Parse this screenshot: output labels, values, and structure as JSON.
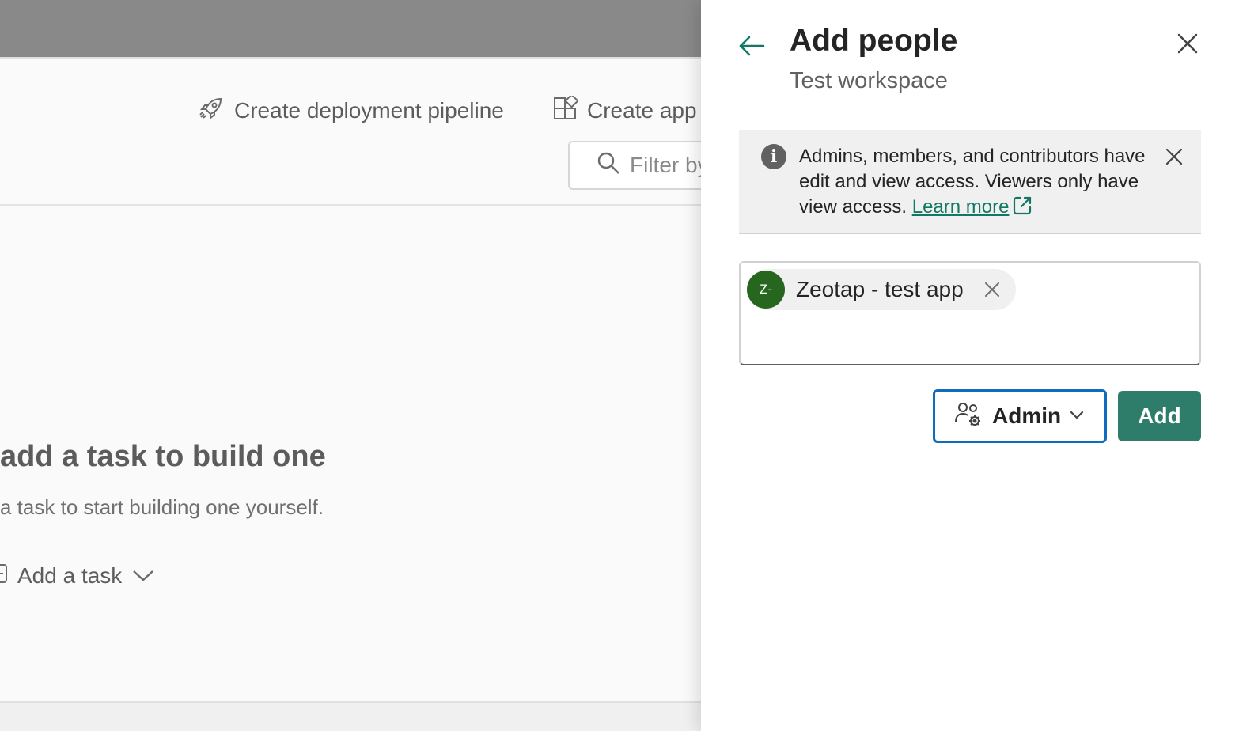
{
  "background": {
    "commands": {
      "pipeline_label": "Create deployment pipeline",
      "app_label": "Create app"
    },
    "filter": {
      "placeholder": "Filter by"
    },
    "empty_state": {
      "title": "add a task to build one",
      "subtitle": "a task to start building one yourself.",
      "add_task_label": "Add a task"
    }
  },
  "panel": {
    "title": "Add people",
    "subtitle": "Test workspace",
    "banner": {
      "message": "Admins, members, and contributors have edit and view access. Viewers only have view access.",
      "link_label": "Learn more"
    },
    "selected_people": [
      {
        "initials": "Z-",
        "name": "Zeotap - test app",
        "avatar_color": "#26661e"
      }
    ],
    "role_selector": {
      "value": "Admin"
    },
    "add_button_label": "Add"
  },
  "colors": {
    "accent": "#2e7d6a",
    "link": "#117865",
    "focus": "#0f6cbd"
  }
}
